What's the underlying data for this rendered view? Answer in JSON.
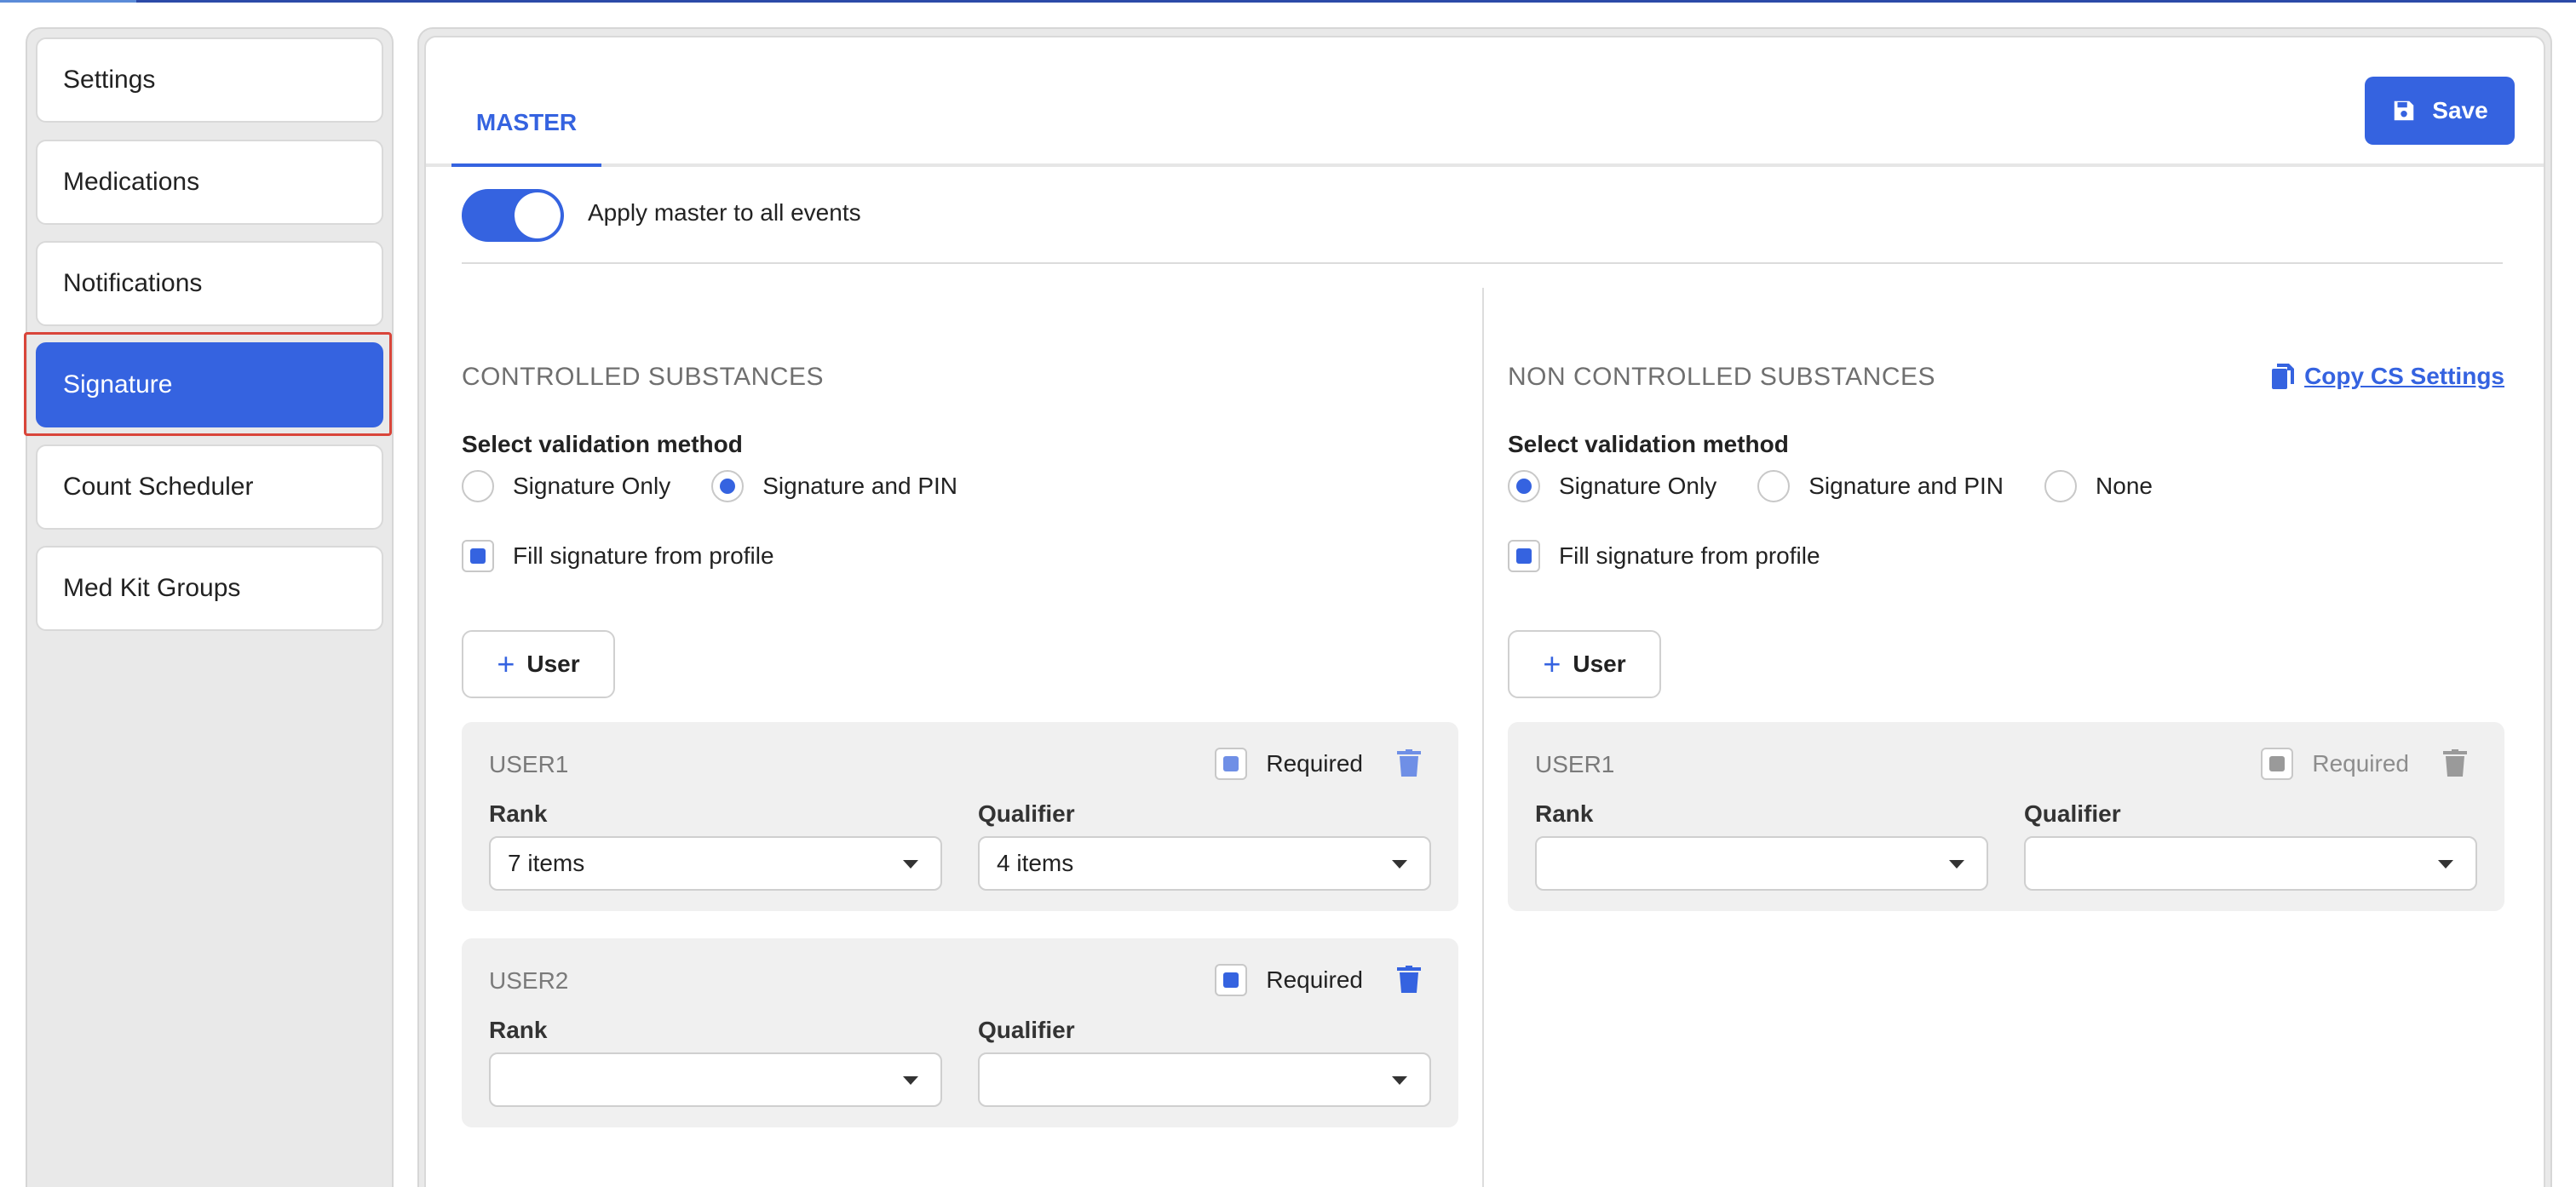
{
  "sidebar": {
    "items": [
      {
        "label": "Settings"
      },
      {
        "label": "Medications"
      },
      {
        "label": "Notifications"
      },
      {
        "label": "Signature",
        "active": true
      },
      {
        "label": "Count Scheduler"
      },
      {
        "label": "Med Kit Groups"
      }
    ]
  },
  "header": {
    "tab_label": "MASTER",
    "save_label": "Save"
  },
  "master_toggle": {
    "label": "Apply master to all events",
    "on": true
  },
  "controlled": {
    "title": "CONTROLLED SUBSTANCES",
    "method_label": "Select validation method",
    "methods": [
      {
        "label": "Signature Only",
        "selected": false
      },
      {
        "label": "Signature and PIN",
        "selected": true
      }
    ],
    "fill_label": "Fill signature from profile",
    "fill_checked": true,
    "add_user_label": "User",
    "users": [
      {
        "name": "USER1",
        "required_label": "Required",
        "required": true,
        "rank_label": "Rank",
        "rank_value": "7 items",
        "qualifier_label": "Qualifier",
        "qualifier_value": "4 items"
      },
      {
        "name": "USER2",
        "required_label": "Required",
        "required": true,
        "rank_label": "Rank",
        "rank_value": "",
        "qualifier_label": "Qualifier",
        "qualifier_value": ""
      }
    ]
  },
  "non_controlled": {
    "title": "NON CONTROLLED SUBSTANCES",
    "copy_label": "Copy CS Settings",
    "method_label": "Select validation method",
    "methods": [
      {
        "label": "Signature Only",
        "selected": true
      },
      {
        "label": "Signature and PIN",
        "selected": false
      },
      {
        "label": "None",
        "selected": false
      }
    ],
    "fill_label": "Fill signature from profile",
    "fill_checked": true,
    "add_user_label": "User",
    "users": [
      {
        "name": "USER1",
        "required_label": "Required",
        "required": false,
        "rank_label": "Rank",
        "rank_value": "",
        "qualifier_label": "Qualifier",
        "qualifier_value": ""
      }
    ]
  },
  "colors": {
    "accent": "#3563e0",
    "highlight_outline": "#d9453a"
  }
}
